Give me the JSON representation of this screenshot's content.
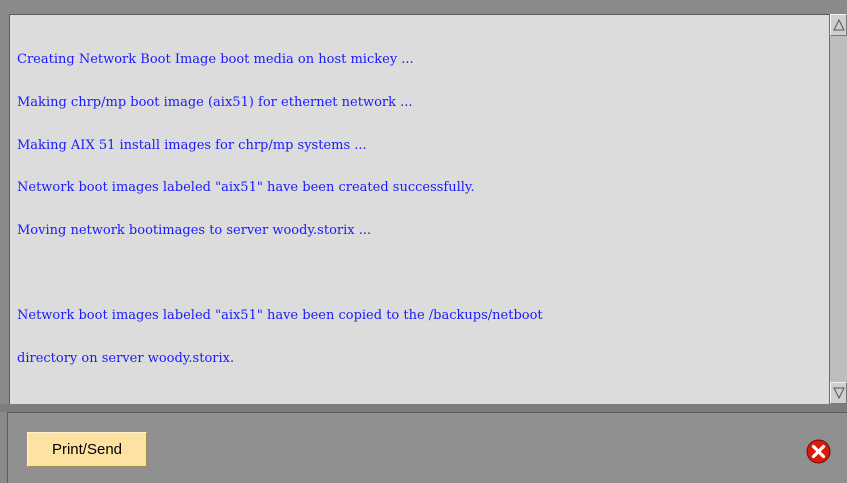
{
  "output": {
    "lines": [
      "Creating Network Boot Image boot media on host mickey ...",
      "Making chrp/mp boot image (aix51) for ethernet network ...",
      "Making AIX 51 install images for chrp/mp systems ...",
      "Network boot images labeled \"aix51\" have been created successfully.",
      "Moving network bootimages to server woody.storix ...",
      "",
      "Network boot images labeled \"aix51\" have been copied to the /backups/netboot",
      "directory on server woody.storix."
    ],
    "text_color": "#1a1aff"
  },
  "toolbar": {
    "print_send_label": "Print/Send",
    "close_icon": "red-circle-x-icon"
  },
  "scrollbar": {
    "up_icon": "triangle-up-icon",
    "down_icon": "triangle-down-icon"
  }
}
